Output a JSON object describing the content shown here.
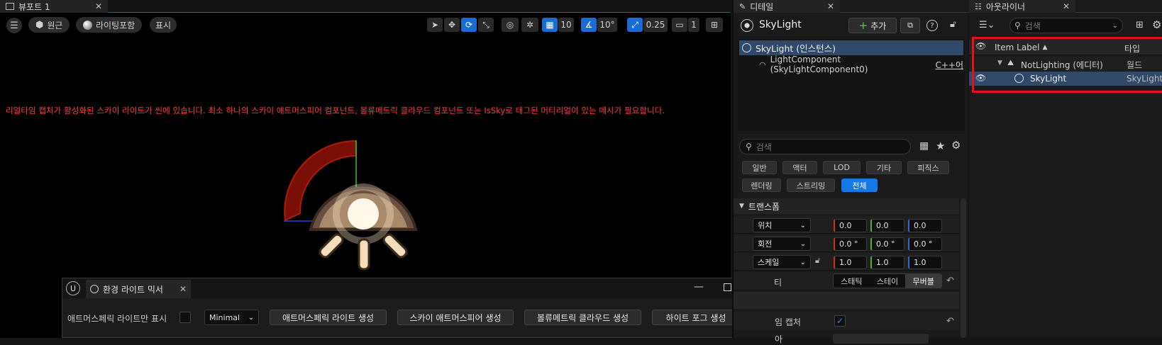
{
  "viewport": {
    "tab_label": "뷰포트 1",
    "toolbar": {
      "perspective_label": "원근",
      "lit_label": "라이팅포함",
      "show_label": "표시",
      "grid_snap_value": "10",
      "rotation_snap_value": "10°",
      "scale_snap_value": "0.25",
      "camera_speed_value": "1"
    },
    "warning_text": "리얼타임 캡처가 활성화된 스카이 라이트가 씬에 있습니다. 최소 하나의 스카이 애트머스피어 컴포넌트, 볼류메트릭 클라우드 컴포넌트 또는 IsSky로 태그된 머티리얼이 있는 메시가 필요합니다."
  },
  "mixer": {
    "tab_label": "환경 라이트 믹서",
    "atmo_only_label": "애트머스페릭 라이트만 표시",
    "mode_value": "Minimal",
    "buttons": [
      "애트머스페릭 라이트 생성",
      "스카이 애트머스피어 생성",
      "볼류메트릭 클라우드 생성",
      "하이트 포그 생성"
    ]
  },
  "details": {
    "tab_label": "디테일",
    "actor_name": "SkyLight",
    "add_label": "추가",
    "tree": {
      "instance_label": "SkyLight (인스턴스)",
      "component_label": "LightComponent (SkyLightComponent0)",
      "component_tag": "C++어"
    },
    "search_placeholder": "검색",
    "filter_chips": [
      "일반",
      "액터",
      "LOD",
      "기타",
      "피직스",
      "렌더링",
      "스트리밍",
      "전체"
    ],
    "active_chip": "전체",
    "transform_header": "트랜스폼",
    "rows": {
      "location_label": "위치",
      "rotation_label": "회전",
      "scale_label": "스케일",
      "location": [
        "0.0",
        "0.0",
        "0.0"
      ],
      "rotation": [
        "0.0 °",
        "0.0 °",
        "0.0 °"
      ],
      "scale": [
        "1.0",
        "1.0",
        "1.0"
      ]
    },
    "mobility_partial_label": "티",
    "mobility_options": [
      "스태틱",
      "스테이",
      "무버블"
    ],
    "capture_partial_label": "임 캡처",
    "capture_checked": true,
    "partial_bottom_label": "아"
  },
  "outliner": {
    "tab_label": "아웃라이너",
    "search_placeholder": "검색",
    "col_label": "Item Label",
    "col_type": "타입",
    "rows": [
      {
        "label": "NotLighting (에디터)",
        "type": "월드"
      },
      {
        "label": "SkyLight",
        "type": "SkyLight"
      }
    ]
  },
  "colors": {
    "accent_blue": "#1478e6",
    "warning_red": "#ff3b3b",
    "highlight_red": "#e8101c",
    "selected_row": "#2f4a6a"
  }
}
